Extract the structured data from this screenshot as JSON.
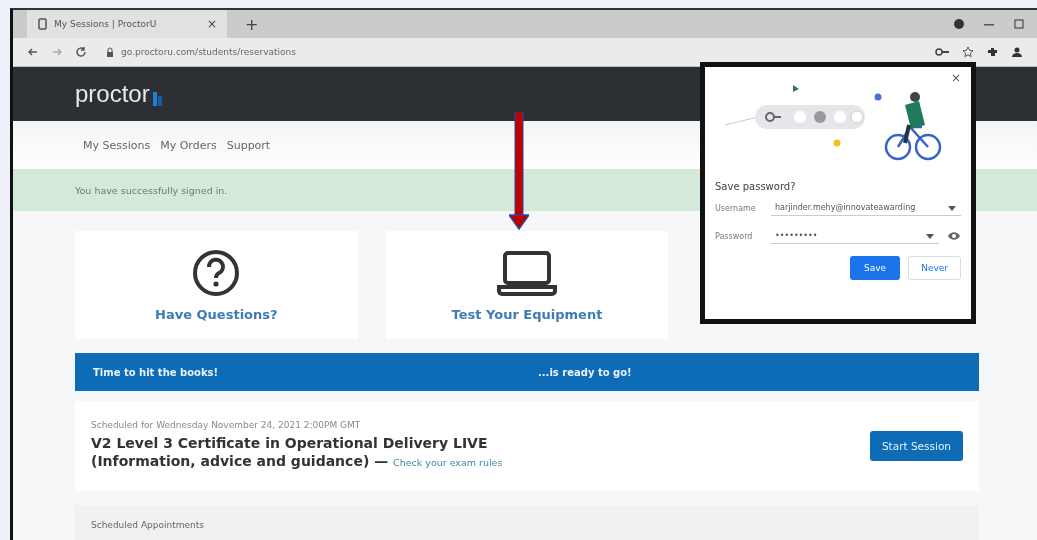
{
  "browser": {
    "tab_title": "My Sessions | ProctorU",
    "tab_close": "×",
    "new_tab": "+",
    "url": "go.proctoru.com/students/reservations"
  },
  "header": {
    "logo": "proctor"
  },
  "nav": [
    {
      "label": "My Sessions"
    },
    {
      "label": "My Orders"
    },
    {
      "label": "Support"
    }
  ],
  "alert": {
    "text": "You have successfully signed in."
  },
  "cards": [
    {
      "kind": "question",
      "label": "Have Questions?"
    },
    {
      "kind": "laptop",
      "label": "Test Your Equipment"
    }
  ],
  "banner": {
    "left": "Time to hit the books!",
    "right": "...is ready to go!"
  },
  "session": {
    "scheduled": "Scheduled for Wednesday November 24, 2021 2:00PM GMT",
    "title": "V2 Level 3 Certificate in Operational Delivery LIVE (Information, advice and guidance)",
    "dash": "—",
    "rules_link": "Check your exam rules",
    "button": "Start Session"
  },
  "appointments": {
    "heading": "Scheduled Appointments"
  },
  "dialog": {
    "close": "×",
    "title": "Save password?",
    "username_label": "Username",
    "username": "harjinder.mehy@innovateawarding",
    "password_label": "Password",
    "password": "•••••••••",
    "save": "Save",
    "never": "Never"
  }
}
